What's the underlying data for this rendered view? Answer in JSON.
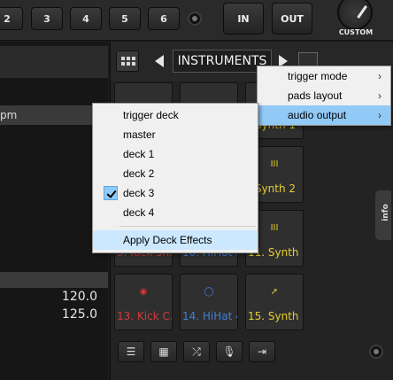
{
  "top": {
    "number_buttons": [
      "2",
      "3",
      "4",
      "5",
      "6"
    ],
    "in_label": "IN",
    "out_label": "OUT",
    "custom_label": "CUSTOM"
  },
  "left": {
    "strip_text": "pm",
    "values": [
      "120.0",
      "125.0"
    ]
  },
  "right": {
    "nav_title": "INSTRUMENTS",
    "info_tab": "info",
    "pads": [
      {
        "label": "",
        "color": "#d03a3a",
        "icon": ""
      },
      {
        "label": "",
        "color": "#3f7fd8",
        "icon": ""
      },
      {
        "label": "Synth 1",
        "color": "#e6cf2e",
        "icon": ""
      },
      {
        "label": "",
        "color": "#d03a3a",
        "icon": ""
      },
      {
        "label": "",
        "color": "#3f7fd8",
        "icon": ""
      },
      {
        "label": "Synth 2",
        "color": "#e6cf2e",
        "icon": "III"
      },
      {
        "label": "9. Kick Sn...",
        "color": "#d03a3a",
        "icon": ""
      },
      {
        "label": "10. HiHat 3",
        "color": "#3f7fd8",
        "icon": ""
      },
      {
        "label": "11. Synth 3",
        "color": "#e6cf2e",
        "icon": "III"
      },
      {
        "label": "13. Kick C...",
        "color": "#d03a3a",
        "icon": "drum-icon"
      },
      {
        "label": "14. HiHat 4",
        "color": "#3f7fd8",
        "icon": "hihat-icon"
      },
      {
        "label": "15. Synth ...",
        "color": "#e6cf2e",
        "icon": "wand-icon"
      }
    ]
  },
  "menu_main": {
    "items": [
      "trigger mode",
      "pads layout",
      "audio output"
    ]
  },
  "menu_sub": {
    "items": [
      "trigger deck",
      "master",
      "deck 1",
      "deck 2",
      "deck 3",
      "deck 4"
    ],
    "checked": "deck 3",
    "action": "Apply Deck Effects"
  }
}
